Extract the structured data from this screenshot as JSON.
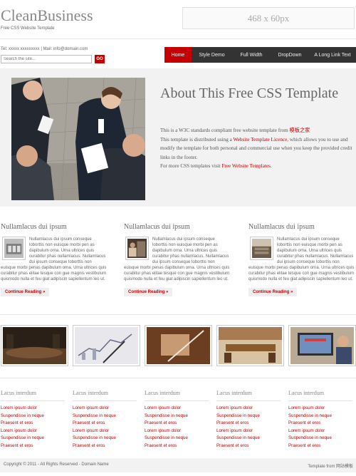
{
  "header": {
    "logo": "CleanBusiness",
    "tagline": "Free CSS Website Template",
    "banner": "468 x 60px"
  },
  "contact": "Tel: xxxxx xxxxxxxxx | Mail: info@domain.com",
  "search": {
    "placeholder": "Search the site...",
    "button": "GO"
  },
  "nav": {
    "items": [
      "Home",
      "Style Demo",
      "Full Width",
      "DropDown",
      "A Long Link Text"
    ],
    "active_color": "#c40000",
    "bar_color": "#333333"
  },
  "hero": {
    "title": "About This Free CSS Template",
    "p1_a": "This is a W3C standards compliant free website template from ",
    "p1_link": "模板之家",
    "p1_b": "This template is distributed using a ",
    "p1_link2": "Website Template Licence",
    "p1_c": ", which allows you to use and modify the template for both personal and commercial use when you keep the provided credit links in the footer.",
    "p2_a": "For more CSS templates visit ",
    "p2_link": "Free Website Templates",
    "p2_b": "."
  },
  "columns": [
    {
      "title": "Nullamlacus dui ipsum",
      "text": "Nullamlacus dui ipsum conseque loborttis non euisque morbi pen as dapibulum orna. Urna ultrices quis curabitur phas nullamlacus. Nullamlacus dui ipsum conseque loborttis non euisque morbi penas dapibulum orna. Urna ultrices quis curabitur phas elitae tesque con gue magnis vestibulum quismodo nulla et feu giat adipiscin sapiellentum leo ut.",
      "continue": "Continue Reading »"
    },
    {
      "title": "Nullamlacus dui ipsum",
      "text": "Nullamlacus dui ipsum conseque loborttis non euisque morbi pen as dapibulum orna. Urna ultrices quis curabitur phas nullamlacus. Nullamlacus dui ipsum conseque loborttis non euisque morbi penas dapibulum orna. Urna ultrices quis curabitur phas elitae tesque con gue magnis vestibulum quismodo nulla et feu giat adipiscin sapiellentum leo ut.",
      "continue": "Continue Reading »"
    },
    {
      "title": "Nullamlacus dui ipsum",
      "text": "Nullamlacus dui ipsum conseque loborttis non euisque morbi pen as dapibulum orna. Urna ultrices quis curabitur phas nullamlacus. Nullamlacus dui ipsum conseque loborttis non euisque morbi penas dapibulum orna. Urna ultrices quis curabitur phas elitae tesque con gue magnis vestibulum quismodo nulla et feu giat adipiscin sapiellentum leo ut.",
      "continue": "Continue Reading »"
    }
  ],
  "link_lists": [
    {
      "title": "Lacus interdum",
      "links": [
        "Lorem ipsum dolor",
        "Suspendisse in neque",
        "Praesent et eros",
        "Lorem ipsum dolor",
        "Suspendisse in neque",
        "Praesent et eros"
      ]
    },
    {
      "title": "Lacus interdum",
      "links": [
        "Lorem ipsum dolor",
        "Suspendisse in neque",
        "Praesent et eros",
        "Lorem ipsum dolor",
        "Suspendisse in neque",
        "Praesent et eros"
      ]
    },
    {
      "title": "Lacus interdum",
      "links": [
        "Lorem ipsum dolor",
        "Suspendisse in neque",
        "Praesent et eros",
        "Lorem ipsum dolor",
        "Suspendisse in neque",
        "Praesent et eros"
      ]
    },
    {
      "title": "Lacus interdum",
      "links": [
        "Lorem ipsum dolor",
        "Suspendisse in neque",
        "Praesent et eros",
        "Lorem ipsum dolor",
        "Suspendisse in neque",
        "Praesent et eros"
      ]
    },
    {
      "title": "Lacus interdum",
      "links": [
        "Lorem ipsum dolor",
        "Suspendisse in neque",
        "Praesent et eros",
        "Lorem ipsum dolor",
        "Suspendisse in neque",
        "Praesent et eros"
      ]
    }
  ],
  "footer": {
    "left": "Copyright © 2011 - All Rights Reserved - Domain Name",
    "right": "Template from 网站模板"
  }
}
